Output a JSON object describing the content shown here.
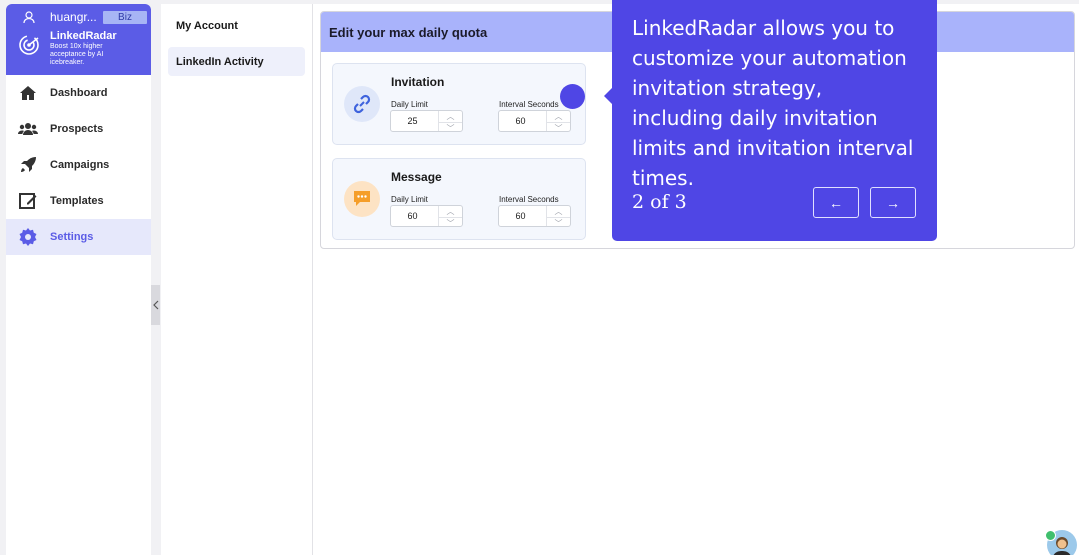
{
  "user": {
    "name": "huangr...",
    "plan": "Biz"
  },
  "brand": {
    "name": "LinkedRadar",
    "tagline": "Boost 10x higher acceptance by AI icebreaker."
  },
  "nav": [
    {
      "label": "Dashboard",
      "icon": "home-icon"
    },
    {
      "label": "Prospects",
      "icon": "users-icon"
    },
    {
      "label": "Campaigns",
      "icon": "rocket-icon"
    },
    {
      "label": "Templates",
      "icon": "edit-icon"
    },
    {
      "label": "Settings",
      "icon": "gear-icon",
      "active": true
    }
  ],
  "subnav": [
    {
      "label": "My Account"
    },
    {
      "label": "LinkedIn Activity",
      "active": true
    }
  ],
  "quota": {
    "title": "Edit your max daily quota",
    "invitation": {
      "title": "Invitation",
      "daily_label": "Daily Limit",
      "daily_value": "25",
      "interval_label": "Interval Seconds",
      "interval_value": "60"
    },
    "message": {
      "title": "Message",
      "daily_label": "Daily Limit",
      "daily_value": "60",
      "interval_label": "Interval Seconds",
      "interval_value": "60"
    }
  },
  "tour": {
    "text": "LinkedRadar allows you to customize your automation invitation strategy, including daily invitation limits and invitation interval times.",
    "step": "2 of 3",
    "prev": "←",
    "next": "→"
  },
  "colors": {
    "accent": "#5b5ce6",
    "tour": "#4f46e5",
    "header": "#a9b3fb"
  }
}
